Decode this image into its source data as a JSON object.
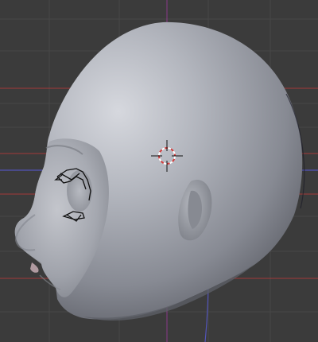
{
  "viewport": {
    "background_color": "#3b3b3b",
    "grid_color": "#474747",
    "x_axis_color": "#b13a3a",
    "y_axis_color": "#5a5ac8",
    "z_axis_color": "#8a3a8a"
  },
  "model": {
    "object": "sculpted-head",
    "view": "left-side",
    "shading": "solid",
    "surface_color": "#a6a9b2"
  },
  "cursor": {
    "icon": "3d-cursor-icon",
    "ring_colors": [
      "#d43c3c",
      "#ffffff"
    ]
  },
  "eye_rig": {
    "icon": "armature-wireframe-icon",
    "wire_color": "#101010"
  }
}
